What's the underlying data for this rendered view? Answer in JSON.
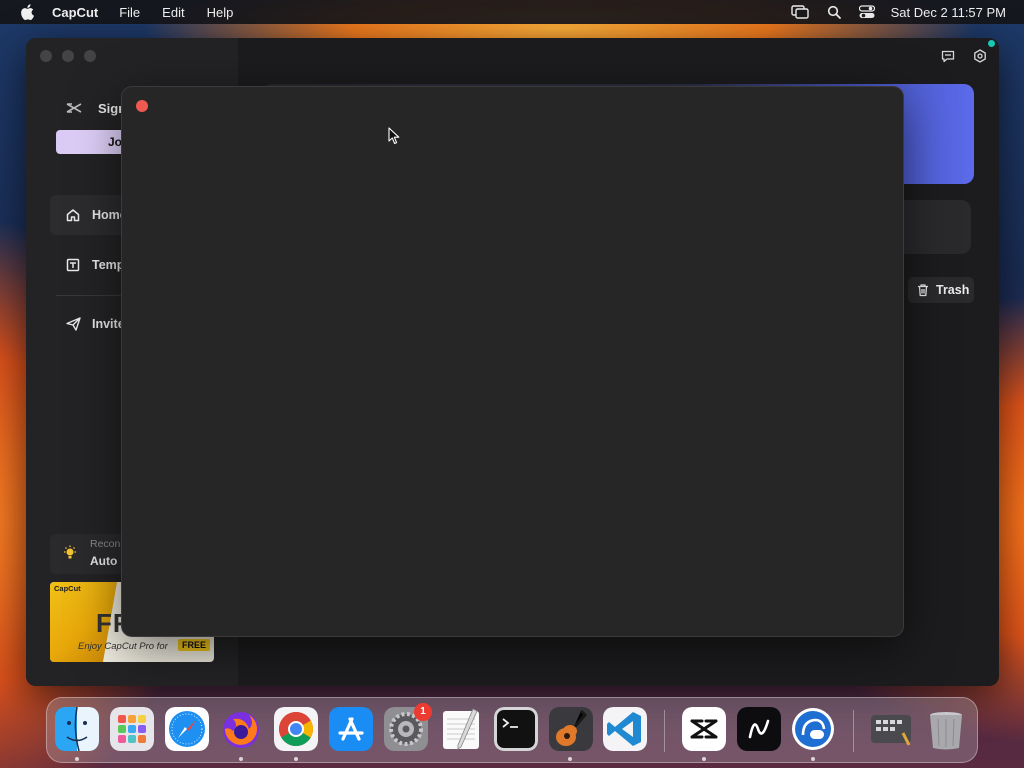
{
  "menubar": {
    "app_name": "CapCut",
    "menus": [
      "File",
      "Edit",
      "Help"
    ],
    "clock": "Sat Dec 2  11:57 PM"
  },
  "sidebar": {
    "signin_label": "Sign",
    "join_label": "Jo",
    "nav": [
      {
        "label": "Home",
        "icon": "home-icon"
      },
      {
        "label": "Temp",
        "icon": "templates-icon"
      },
      {
        "label": "Invite",
        "icon": "send-icon"
      }
    ],
    "recon_title": "Recon",
    "recon_value": "Auto",
    "promo": {
      "brand": "CapCut",
      "headline": "FR",
      "subtitle": "Enjoy CapCut Pro for",
      "tag": "FREE"
    }
  },
  "main": {
    "trash_label": "Trash"
  },
  "dock": {
    "apps": [
      "Finder",
      "Launchpad",
      "Safari",
      "Firefox",
      "Chrome",
      "App Store",
      "System Settings",
      "TextEdit",
      "Terminal",
      "GarageBand",
      "VS Code",
      "CapCut",
      "Linear",
      "Proxyman",
      "Screenshot",
      "Trash"
    ],
    "settings_badge": "1"
  },
  "colors": {
    "accent_red": "#ee5a52",
    "online": "#19c7b5",
    "badge": "#ec3b30"
  }
}
